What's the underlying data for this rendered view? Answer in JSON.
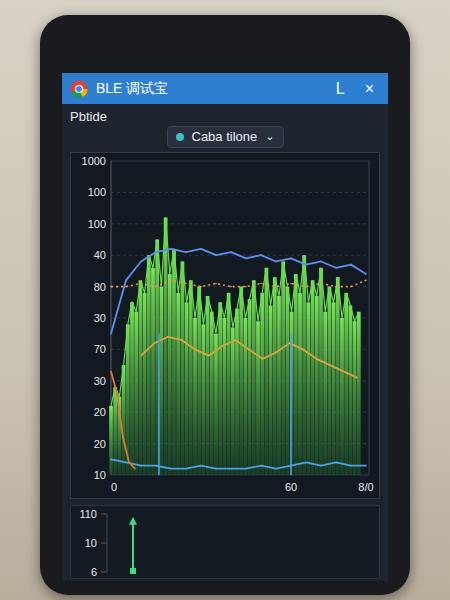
{
  "window": {
    "title": "BLE 调试宝",
    "controls": [
      "L",
      "×"
    ]
  },
  "panel": {
    "label": "Pbtide"
  },
  "selector": {
    "label": "Caba tilone",
    "caret": "⌄",
    "color": "#3cc0c4"
  },
  "chart": {
    "y_ticks": [
      "10",
      "20",
      "20",
      "30",
      "70",
      "30",
      "80",
      "40",
      "100",
      "100",
      "1000"
    ],
    "x_ticks": [
      {
        "label": "0",
        "x": 0
      },
      {
        "label": "60",
        "x": 60
      },
      {
        "label": "8/0",
        "x": 85
      }
    ],
    "markers": [
      {
        "x": 16,
        "top": 45,
        "color": "#4aa3e8"
      },
      {
        "x": 60,
        "top": 45,
        "color": "#4aa3e8"
      }
    ],
    "series": [
      {
        "kind": "bars",
        "color": "#62dd4c",
        "x_start": 0,
        "x_step": 1.4,
        "values": [
          22,
          28,
          25,
          35,
          48,
          55,
          52,
          62,
          58,
          70,
          66,
          75,
          60,
          82,
          64,
          72,
          58,
          68,
          55,
          62,
          50,
          60,
          48,
          57,
          52,
          45,
          55,
          50,
          58,
          47,
          53,
          60,
          50,
          56,
          62,
          49,
          58,
          66,
          54,
          63,
          57,
          68,
          60,
          52,
          64,
          58,
          70,
          55,
          62,
          57,
          66,
          52,
          60,
          55,
          63,
          50,
          58,
          54,
          49,
          52
        ]
      },
      {
        "kind": "line",
        "color": "#5b8ff0",
        "x_start": 0,
        "x_step": 5,
        "values": [
          45,
          62,
          68,
          71,
          72,
          71,
          72,
          70,
          71,
          69,
          70,
          68,
          69,
          67,
          68,
          66,
          67,
          64
        ]
      },
      {
        "kind": "dotted",
        "color": "#e89a4a",
        "x_start": 0,
        "x_step": 5,
        "values": [
          60,
          60,
          61,
          60,
          62,
          61,
          60,
          61,
          60,
          60,
          61,
          60,
          61,
          60,
          61,
          60,
          60,
          62
        ]
      },
      {
        "kind": "line",
        "color": "#d9a53a",
        "x_start": 10,
        "x_step": 4.5,
        "values": [
          38,
          42,
          44,
          43,
          40,
          38,
          41,
          43,
          40,
          37,
          39,
          42,
          40,
          37,
          35,
          33,
          31
        ]
      },
      {
        "kind": "line",
        "color": "#4aa3e8",
        "x_start": 0,
        "x_step": 5,
        "values": [
          5,
          4,
          3,
          3,
          2,
          2,
          3,
          2,
          2,
          2,
          3,
          2,
          3,
          4,
          3,
          4,
          3,
          3
        ]
      },
      {
        "kind": "line",
        "color": "#e0782e",
        "x_start": 0,
        "x_step": 2,
        "values": [
          33,
          26,
          12,
          4,
          2
        ]
      }
    ]
  },
  "sub_chart": {
    "y_ticks": [
      "6",
      "10",
      "110"
    ],
    "arrow": {
      "x": 10,
      "level": 0.92,
      "color": "#3ddc84"
    }
  }
}
